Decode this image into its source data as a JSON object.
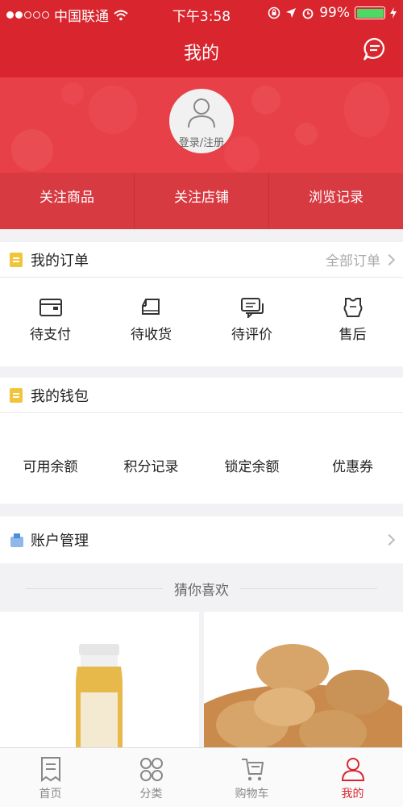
{
  "status": {
    "carrier": "中国联通",
    "time": "下午3:58",
    "battery": "99%"
  },
  "header": {
    "title": "我的"
  },
  "profile": {
    "login_label": "登录/注册"
  },
  "follow": [
    "关注商品",
    "关注店铺",
    "浏览记录"
  ],
  "orders": {
    "title": "我的订单",
    "all_label": "全部订单",
    "items": [
      "待支付",
      "待收货",
      "待评价",
      "售后"
    ]
  },
  "wallet": {
    "title": "我的钱包",
    "items": [
      "可用余额",
      "积分记录",
      "锁定余额",
      "优惠券"
    ]
  },
  "account": {
    "title": "账户管理"
  },
  "recommend": {
    "title": "猜你喜欢"
  },
  "tabbar": {
    "items": [
      "首页",
      "分类",
      "购物车",
      "我的"
    ],
    "active": "我的"
  },
  "colors": {
    "brand": "#d9262e",
    "banner": "#e84049",
    "accent_yellow": "#f2c43a"
  }
}
